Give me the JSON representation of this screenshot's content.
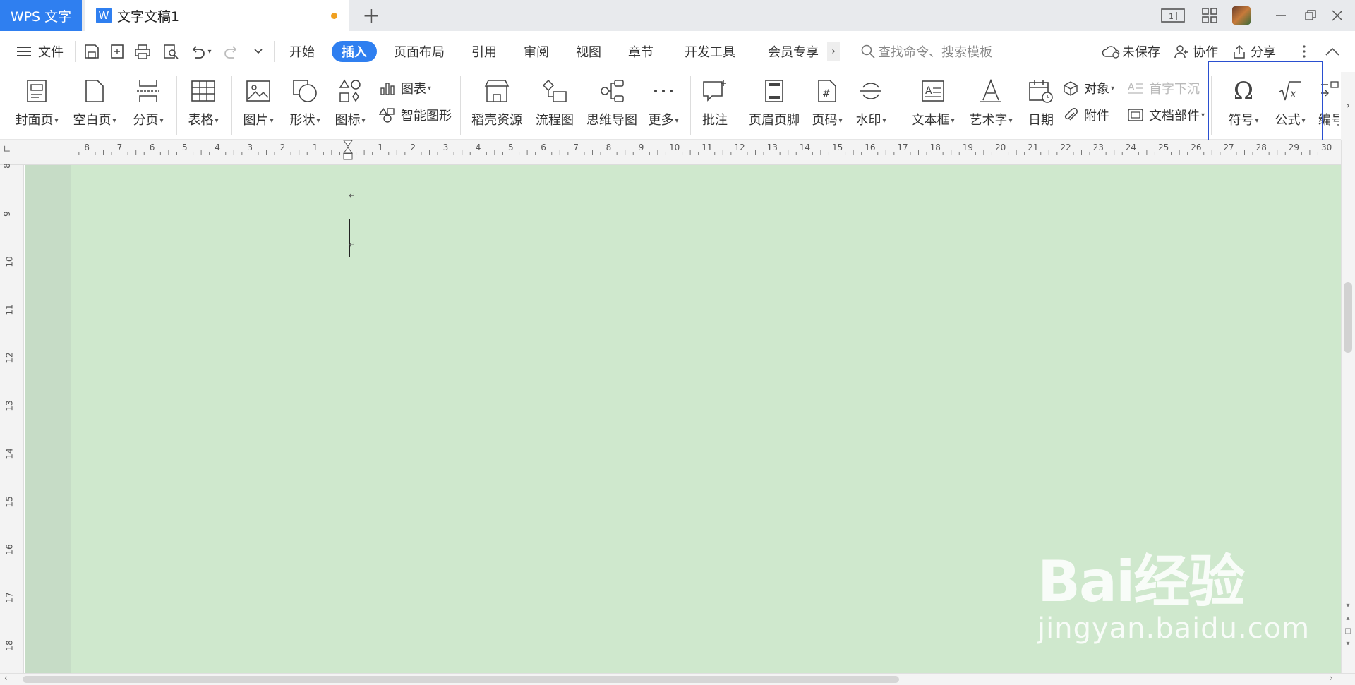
{
  "titlebar": {
    "app_name": "WPS 文字",
    "doc_name": "文字文稿1",
    "new_tab": "+"
  },
  "menu": {
    "file_label": "文件",
    "tabs": [
      "开始",
      "插入",
      "页面布局",
      "引用",
      "审阅",
      "视图",
      "章节",
      "开发工具",
      "会员专享"
    ],
    "active_tab": "插入",
    "search_placeholder": "查找命令、搜索模板",
    "unsaved_label": "未保存",
    "collab_label": "协作",
    "share_label": "分享"
  },
  "ribbon": {
    "cover": "封面页",
    "blank": "空白页",
    "pagebreak": "分页",
    "table": "表格",
    "picture": "图片",
    "shape": "形状",
    "icon": "图标",
    "chart": "图表",
    "smartart": "智能图形",
    "resource": "稻壳资源",
    "flowchart": "流程图",
    "mindmap": "思维导图",
    "more": "更多",
    "comment": "批注",
    "header_footer": "页眉页脚",
    "page_number": "页码",
    "watermark": "水印",
    "textbox": "文本框",
    "wordart": "艺术字",
    "date": "日期",
    "object": "对象",
    "dropcap": "首字下沉",
    "attachment": "附件",
    "doc_parts": "文档部件",
    "symbol": "符号",
    "formula": "公式",
    "numbering": "编号"
  },
  "ruler": {
    "left_numbers": [
      "8",
      "7",
      "6",
      "5",
      "4",
      "3",
      "2",
      "1"
    ],
    "right_numbers": [
      "1",
      "2",
      "3",
      "4",
      "5",
      "6",
      "7",
      "8",
      "9",
      "10",
      "11",
      "12",
      "13",
      "14",
      "15",
      "16",
      "17",
      "18",
      "19",
      "20",
      "21",
      "22",
      "23",
      "24",
      "25",
      "26",
      "27",
      "28",
      "29",
      "30"
    ],
    "vertical_numbers": [
      "8",
      "9",
      "10",
      "11",
      "12",
      "13",
      "14",
      "15",
      "16",
      "17",
      "18"
    ]
  },
  "watermark": {
    "brand": "Bai经验",
    "url": "jingyan.baidu.com"
  },
  "colors": {
    "accent": "#2f7ff0",
    "page_bg": "#cfe8cd",
    "highlight": "#2a4fd0",
    "unsaved_dot": "#f0a020"
  }
}
